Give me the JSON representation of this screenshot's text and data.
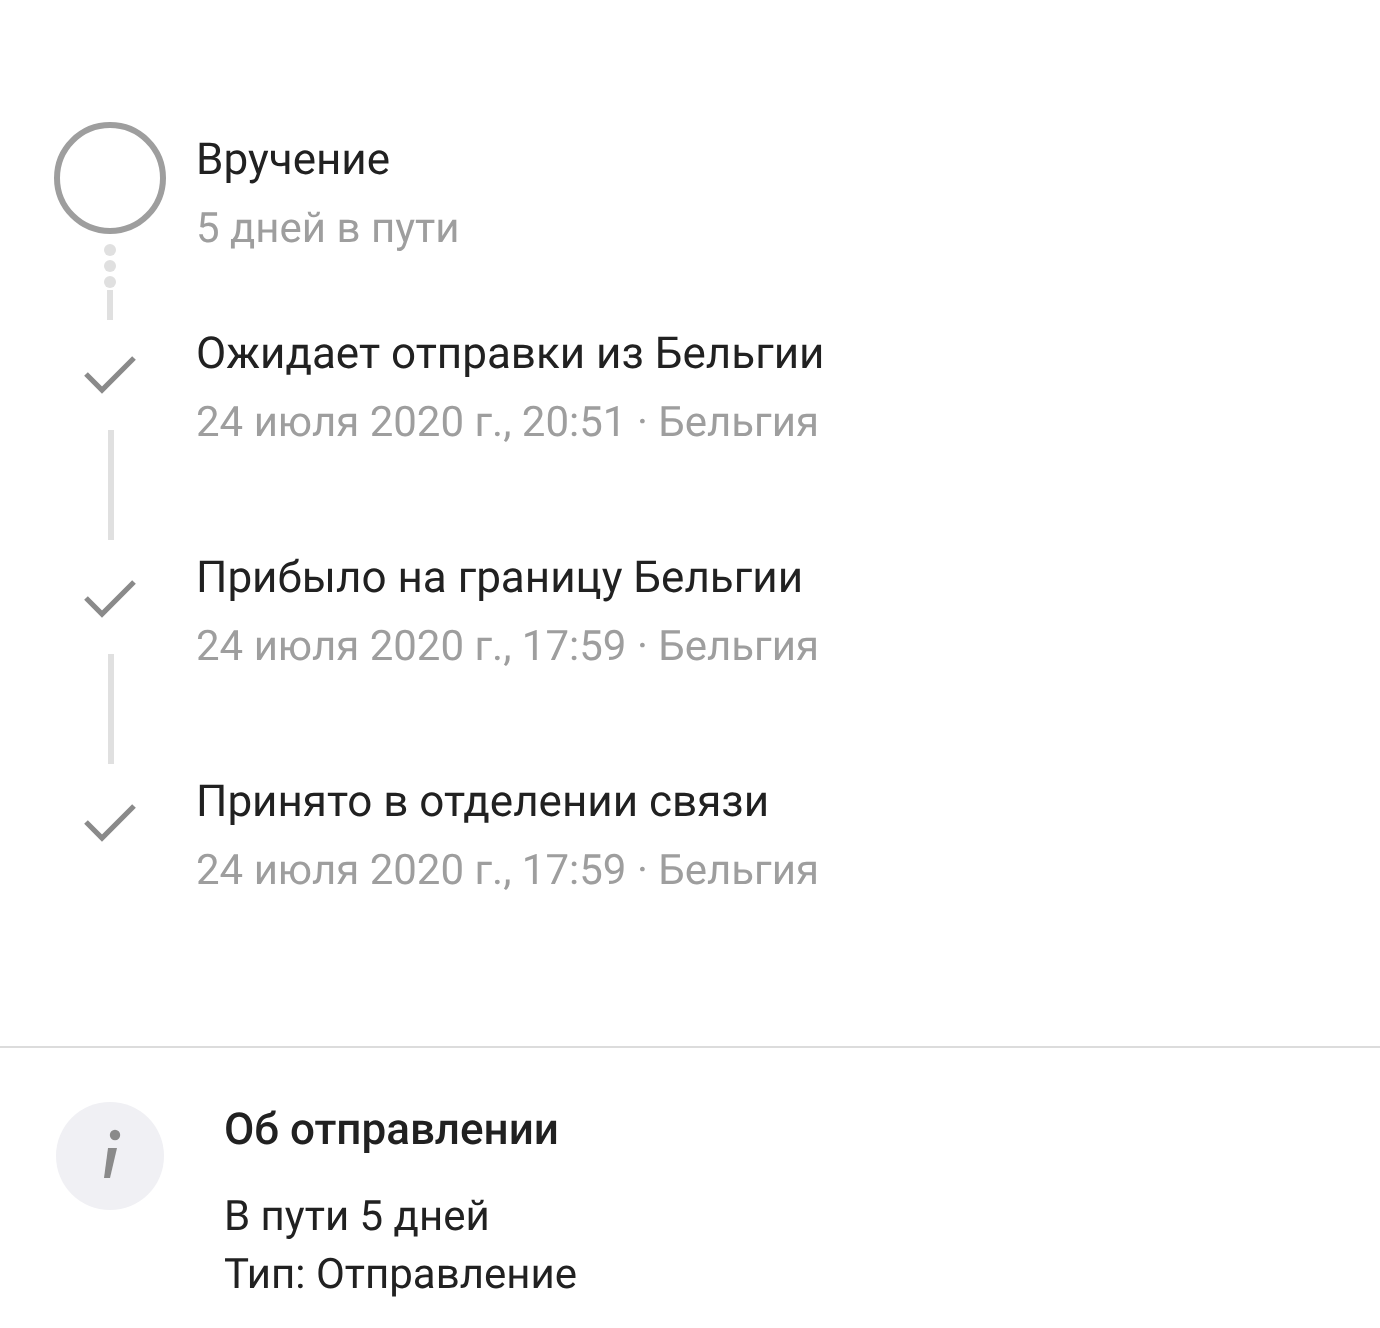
{
  "events": [
    {
      "kind": "pending",
      "title": "Вручение",
      "subtitle": "5 дней в пути"
    },
    {
      "kind": "done",
      "title": "Ожидает отправки из Бельгии",
      "subtitle": "24 июля 2020 г., 20:51 · Бельгия"
    },
    {
      "kind": "done",
      "title": "Прибыло на границу Бельгии",
      "subtitle": "24 июля 2020 г., 17:59 · Бельгия"
    },
    {
      "kind": "done",
      "title": "Принято в отделении связи",
      "subtitle": "24 июля 2020 г., 17:59 · Бельгия"
    }
  ],
  "info": {
    "title": "Об отправлении",
    "lines": [
      "В пути 5 дней",
      "Тип: Отправление"
    ]
  }
}
